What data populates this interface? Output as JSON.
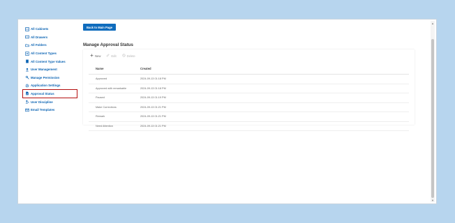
{
  "sidebar": {
    "items": [
      {
        "label": "All Cabinets",
        "icon": "cabinet-icon"
      },
      {
        "label": "All Drawers",
        "icon": "drawer-icon"
      },
      {
        "label": "All Folders",
        "icon": "folder-icon"
      },
      {
        "label": "All Content Types",
        "icon": "content-types-icon"
      },
      {
        "label": "All Content Type Values",
        "icon": "content-type-values-icon"
      },
      {
        "label": "User Management",
        "icon": "user-management-icon"
      },
      {
        "label": "Manage Permission",
        "icon": "permission-icon"
      },
      {
        "label": "Application Settings",
        "icon": "settings-icon"
      },
      {
        "label": "Approval Status",
        "icon": "approval-status-icon"
      },
      {
        "label": "User Discipline",
        "icon": "user-discipline-icon"
      },
      {
        "label": "Email Templates",
        "icon": "email-icon"
      }
    ],
    "active_index": 8
  },
  "main": {
    "back_button": "Back to Main Page",
    "title": "Manage Approval Status",
    "toolbar": {
      "new": "New",
      "edit": "Edit",
      "delete": "Delete"
    },
    "columns": [
      "Name",
      "Created"
    ],
    "rows": [
      {
        "name": "Approved",
        "created": "2024-09-13 01:18 PM"
      },
      {
        "name": "Approved with remarkable",
        "created": "2024-09-13 01:18 PM"
      },
      {
        "name": "Paused",
        "created": "2024-09-13 01:19 PM"
      },
      {
        "name": "Make Corrections",
        "created": "2024-09-13 01:21 PM"
      },
      {
        "name": "Remark",
        "created": "2024-09-13 01:21 PM"
      },
      {
        "name": "Need Attention",
        "created": "2024-09-13 01:21 PM"
      }
    ]
  },
  "colors": {
    "accent": "#0f6cbd",
    "link": "#0a63b3",
    "highlight": "#b40e0e",
    "background": "#b7d5ee"
  }
}
